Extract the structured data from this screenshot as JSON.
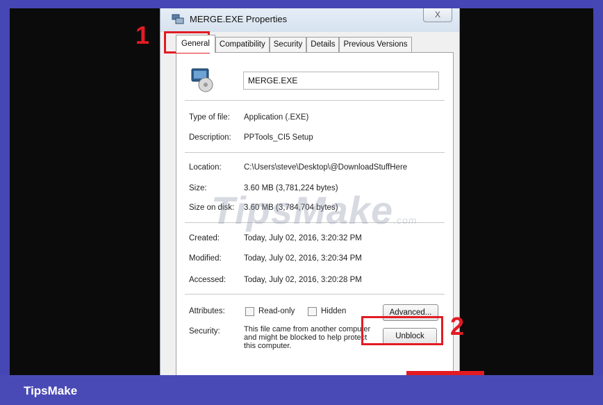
{
  "window": {
    "title": "MERGE.EXE Properties",
    "close_label": "X"
  },
  "tabs": [
    {
      "label": "General"
    },
    {
      "label": "Compatibility"
    },
    {
      "label": "Security"
    },
    {
      "label": "Details"
    },
    {
      "label": "Previous Versions"
    }
  ],
  "general": {
    "file_name": "MERGE.EXE",
    "type_label": "Type of file:",
    "type_value": "Application (.EXE)",
    "description_label": "Description:",
    "description_value": "PPTools_CI5 Setup",
    "location_label": "Location:",
    "location_value": "C:\\Users\\steve\\Desktop\\@DownloadStuffHere",
    "size_label": "Size:",
    "size_value": "3.60 MB (3,781,224 bytes)",
    "size_on_disk_label": "Size on disk:",
    "size_on_disk_value": "3.60 MB (3,784,704 bytes)",
    "created_label": "Created:",
    "created_value": "Today, July 02, 2016, 3:20:32 PM",
    "modified_label": "Modified:",
    "modified_value": "Today, July 02, 2016, 3:20:34 PM",
    "accessed_label": "Accessed:",
    "accessed_value": "Today, July 02, 2016, 3:20:28 PM",
    "attributes_label": "Attributes:",
    "readonly_label": "Read-only",
    "hidden_label": "Hidden",
    "advanced_button": "Advanced...",
    "security_label": "Security:",
    "security_text": "This file came from another computer and might be blocked to help protect this computer.",
    "unblock_button": "Unblock"
  },
  "annotations": {
    "step1": "1",
    "step2": "2",
    "color": "#e21b23"
  },
  "watermark": {
    "text": "TipsMake",
    "suffix": ".com"
  },
  "footer": {
    "brand": "TipsMake",
    "background": "#4a4ab6"
  }
}
